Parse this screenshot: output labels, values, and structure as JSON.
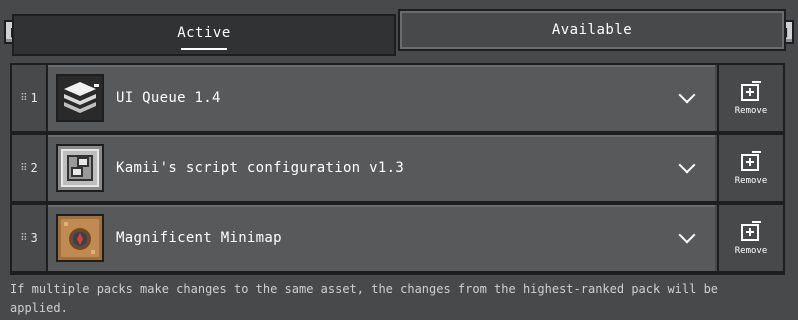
{
  "shoulder_keys": {
    "left": "[",
    "right": "]"
  },
  "tabs": [
    {
      "label": "Active",
      "selected": true
    },
    {
      "label": "Available",
      "selected": false
    }
  ],
  "packs": [
    {
      "rank": "1",
      "name": "UI Queue 1.4",
      "icon": "stacked-layers-icon",
      "remove_label": "Remove"
    },
    {
      "rank": "2",
      "name": "Kamii's script configuration v1.3",
      "icon": "sliders-config-icon",
      "remove_label": "Remove"
    },
    {
      "rank": "3",
      "name": "Magnificent Minimap",
      "icon": "minimap-compass-icon",
      "remove_label": "Remove"
    }
  ],
  "hint": "If multiple packs make changes to the same asset, the changes from the highest-ranked pack will be applied.",
  "colors": {
    "background": "#48494a",
    "panel": "#313233",
    "row": "#58595b",
    "border": "#1e1e1f",
    "text": "#ffffff"
  }
}
